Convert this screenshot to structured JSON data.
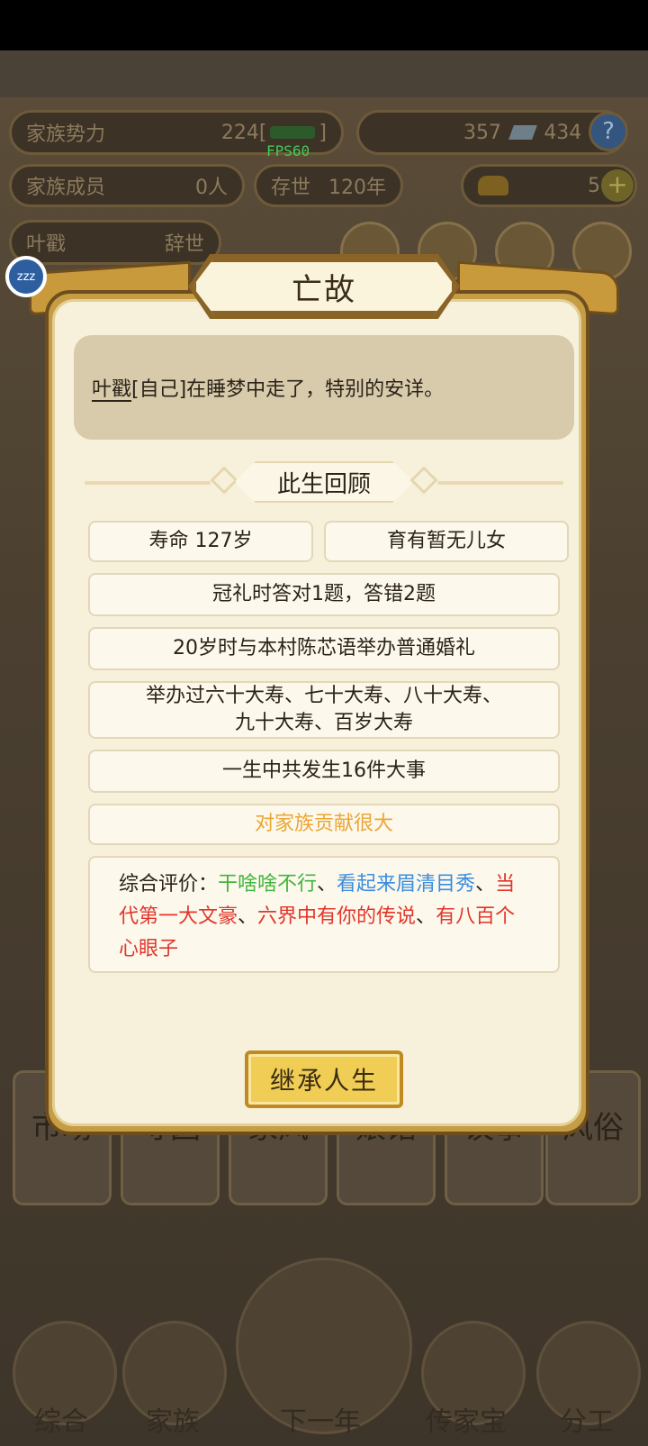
{
  "status": {
    "fps": "FPS60"
  },
  "background": {
    "clan_power_label": "家族势力",
    "clan_power_value": "224[",
    "clan_power_suffix": "]",
    "silver": "357",
    "coins": "434",
    "help": "?",
    "members_label": "家族成员",
    "members_value": "0人",
    "generations_label": "存世",
    "generations_value": "120年",
    "gold": "58",
    "plus": "+",
    "person_name": "叶戳",
    "person_status": "辞世",
    "bottom_cards": [
      "市场",
      "寻园",
      "家风",
      "娘馆",
      "议事",
      "风俗"
    ],
    "nav": [
      "综合",
      "家族",
      "下一年",
      "传家宝",
      "分工"
    ]
  },
  "dialog": {
    "badge": "zzz",
    "title": "亡故",
    "message_name": "叶戳",
    "message_rest": "[自己]在睡梦中走了，特别的安详。",
    "section_title": "此生回顾",
    "lifespan": "寿命 127岁",
    "children": "育有暂无儿女",
    "capping": "冠礼时答对1题，答错2题",
    "wedding": "20岁时与本村陈芯语举办普通婚礼",
    "birthdays_line1": "举办过六十大寿、七十大寿、八十大寿、",
    "birthdays_line2": "九十大寿、百岁大寿",
    "events": "一生中共发生16件大事",
    "contribution": "对家族贡献很大",
    "eval_label": "综合评价：",
    "eval_1": "干啥啥不行",
    "eval_sep1": "、",
    "eval_2": "看起来眉清目秀",
    "eval_sep2": "、",
    "eval_3": "当代第一大文豪",
    "eval_sep3": "、",
    "eval_4": "六界中有你的传说",
    "eval_sep4": "、",
    "eval_5": "有八百个心眼子",
    "inherit_button": "继承人生"
  },
  "colors": {
    "accent_gold": "#eba636",
    "trait_green": "#41b53c",
    "trait_blue": "#3a8dde",
    "trait_red": "#e2352b",
    "dialog_frame": "#c69d44"
  }
}
